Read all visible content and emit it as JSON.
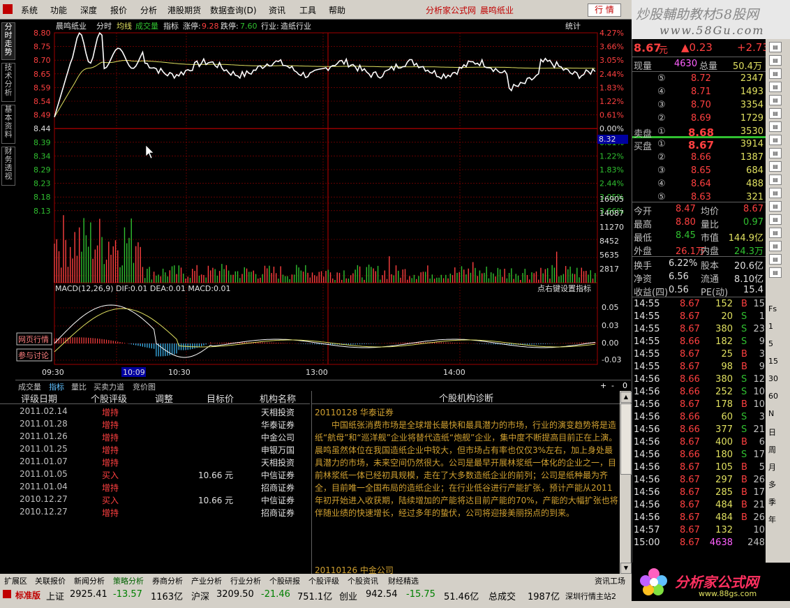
{
  "menu": {
    "items": [
      "系统",
      "功能",
      "深度",
      "报价",
      "分析",
      "港股期货",
      "数据查询(D)",
      "资讯",
      "工具",
      "帮助"
    ],
    "brand": "分析家公式网",
    "stock_name": "晨鸣纸业",
    "quote_button": "行 情"
  },
  "watermark": {
    "line1": "炒股輔助教材58股网",
    "line2": "www.58Gu.com"
  },
  "left_tabs": [
    "分时走势",
    "技术分析",
    "基本资料",
    "财务透视"
  ],
  "chart": {
    "header": {
      "name": "晨鸣纸业",
      "minute": "分时",
      "avg": "均线",
      "vol": "成交量",
      "indicator": "指标",
      "limit_up_label": "涨停:",
      "limit_up": "9.28",
      "limit_down_label": "跌停:",
      "limit_down": "7.60",
      "industry_label": "行业:",
      "industry": "造纸行业",
      "stats": "统计"
    },
    "price_left_ticks": [
      "8.80",
      "8.75",
      "8.70",
      "8.65",
      "8.59",
      "8.54",
      "8.49",
      "8.44",
      "8.39",
      "8.34",
      "8.29",
      "8.23",
      "8.18",
      "8.13"
    ],
    "pct_right_ticks": [
      "4.27%",
      "3.66%",
      "3.05%",
      "2.44%",
      "1.83%",
      "1.22%",
      "0.61%",
      "0.00%",
      "0.61%",
      "1.22%",
      "1.83%",
      "2.44%",
      "3.05%",
      "3.66%"
    ],
    "cursor_price": "8.32",
    "vol_ticks": [
      "16905",
      "14087",
      "11270",
      "8452",
      "5635",
      "2817"
    ],
    "macd_header": "MACD(12,26,9)  DIF:0.01  DEA:0.01  MACD:0.01",
    "macd_hint": "点右键设置指标",
    "macd_ticks": [
      "0.05",
      "0.03",
      "0.00",
      "-0.03"
    ],
    "side_buttons": [
      "网页行情",
      "参与讨论"
    ],
    "time_labels": [
      "09:30",
      "10:09",
      "10:30",
      "13:00",
      "14:00"
    ]
  },
  "chart_tabs": [
    "成交量",
    "指标",
    "量比",
    "买卖力道",
    "竞价图"
  ],
  "chart_tab_controls": [
    "+",
    "-",
    "0"
  ],
  "rating": {
    "headers": [
      "评级日期",
      "个股评级",
      "调整",
      "目标价",
      "机构名称"
    ],
    "rows": [
      {
        "date": "2011.02.14",
        "rating": "增持",
        "adjust": "",
        "target": "",
        "org": "天相投资",
        "buy": false
      },
      {
        "date": "2011.01.28",
        "rating": "增持",
        "adjust": "",
        "target": "",
        "org": "华泰证券",
        "buy": false
      },
      {
        "date": "2011.01.26",
        "rating": "增持",
        "adjust": "",
        "target": "",
        "org": "中金公司",
        "buy": false
      },
      {
        "date": "2011.01.25",
        "rating": "增持",
        "adjust": "",
        "target": "",
        "org": "申银万国",
        "buy": false
      },
      {
        "date": "2011.01.07",
        "rating": "增持",
        "adjust": "",
        "target": "",
        "org": "天相投资",
        "buy": false
      },
      {
        "date": "2011.01.05",
        "rating": "买入",
        "adjust": "",
        "target": "10.66 元",
        "org": "中信证券",
        "buy": true
      },
      {
        "date": "2011.01.04",
        "rating": "增持",
        "adjust": "",
        "target": "",
        "org": "招商证券",
        "buy": false
      },
      {
        "date": "2010.12.27",
        "rating": "买入",
        "adjust": "",
        "target": "10.66 元",
        "org": "中信证券",
        "buy": true
      },
      {
        "date": "2010.12.27",
        "rating": "增持",
        "adjust": "",
        "target": "",
        "org": "招商证券",
        "buy": false
      }
    ]
  },
  "diagnosis": {
    "title": "个股机构诊断",
    "date1": "20110128  华泰证券",
    "body": "中国纸张消费市场是全球增长最快和最具潜力的市场，行业的演变趋势将是造纸“航母”和“巡洋舰”企业将替代造纸“炮舰”企业，集中度不断提高目前正在上演。晨鸣虽然体位在我国造纸企业中较大，但市场占有率也仅仅3%左右，加上身处最具潜力的市场，未来空间仍然很大。公司是最早开展林浆纸一体化的企业之一，目前林浆纸一体已经初具规模，走在了大多数造纸企业的前列；公司是纸种最为齐全，目前唯一全国布局的造纸企业；在行业低谷进行产能扩张，预计产能从2011年初开始进入收获期，陆续增加的产能将达目前产能的70%，产能的大幅扩张也将伴随业绩的快速增长，经过多年的蛰伏，公司将迎接美丽拐点的到来。",
    "date2": "20110126  中金公司"
  },
  "quote": {
    "price": "8.67",
    "unit": "元",
    "change": "▲0.23",
    "pct": "+2.73",
    "xianliang_label": "现量",
    "xianliang": "4630",
    "zongliang_label": "总量",
    "zongliang": "50.4万",
    "sell": [
      {
        "lvl": "⑤",
        "price": "8.72",
        "vol": "2347"
      },
      {
        "lvl": "④",
        "price": "8.71",
        "vol": "1493"
      },
      {
        "lvl": "③",
        "price": "8.70",
        "vol": "3354"
      },
      {
        "lvl": "②",
        "price": "8.69",
        "vol": "1729"
      },
      {
        "lvl": "①",
        "price": "8.68",
        "vol": "3530",
        "label": "卖盘"
      }
    ],
    "buy": [
      {
        "lvl": "①",
        "price": "8.67",
        "vol": "3914",
        "label": "买盘"
      },
      {
        "lvl": "②",
        "price": "8.66",
        "vol": "1387"
      },
      {
        "lvl": "③",
        "price": "8.65",
        "vol": "684"
      },
      {
        "lvl": "④",
        "price": "8.64",
        "vol": "488"
      },
      {
        "lvl": "⑤",
        "price": "8.63",
        "vol": "321"
      }
    ],
    "stats": [
      {
        "l1": "今开",
        "v1": "8.47",
        "l2": "均价",
        "v2": "8.67"
      },
      {
        "l1": "最高",
        "v1": "8.80",
        "l2": "量比",
        "v2": "0.97"
      },
      {
        "l1": "最低",
        "v1": "8.45",
        "l2": "市值",
        "v2": "144.9亿"
      },
      {
        "l1": "外盘",
        "v1": "26.1万",
        "l2": "内盘",
        "v2": "24.3万"
      }
    ],
    "fund": [
      {
        "l1": "换手",
        "v1": "6.22%",
        "l2": "股本",
        "v2": "20.6亿"
      },
      {
        "l1": "净资",
        "v1": "6.56",
        "l2": "流通",
        "v2": "8.10亿"
      },
      {
        "l1": "收益(四)",
        "v1": "0.56",
        "l2": "PE(动)",
        "v2": "15.4"
      }
    ],
    "ticks": [
      {
        "t": "14:55",
        "p": "8.67",
        "v": "152",
        "d": "B",
        "n": "15"
      },
      {
        "t": "14:55",
        "p": "8.67",
        "v": "20",
        "d": "S",
        "n": "1"
      },
      {
        "t": "14:55",
        "p": "8.67",
        "v": "380",
        "d": "S",
        "n": "23"
      },
      {
        "t": "14:55",
        "p": "8.66",
        "v": "182",
        "d": "S",
        "n": "9"
      },
      {
        "t": "14:55",
        "p": "8.67",
        "v": "25",
        "d": "B",
        "n": "3"
      },
      {
        "t": "14:55",
        "p": "8.67",
        "v": "98",
        "d": "B",
        "n": "9"
      },
      {
        "t": "14:56",
        "p": "8.66",
        "v": "380",
        "d": "S",
        "n": "12"
      },
      {
        "t": "14:56",
        "p": "8.66",
        "v": "252",
        "d": "S",
        "n": "10"
      },
      {
        "t": "14:56",
        "p": "8.67",
        "v": "178",
        "d": "B",
        "n": "10"
      },
      {
        "t": "14:56",
        "p": "8.66",
        "v": "60",
        "d": "S",
        "n": "3"
      },
      {
        "t": "14:56",
        "p": "8.66",
        "v": "377",
        "d": "S",
        "n": "21"
      },
      {
        "t": "14:56",
        "p": "8.67",
        "v": "400",
        "d": "B",
        "n": "6"
      },
      {
        "t": "14:56",
        "p": "8.66",
        "v": "180",
        "d": "S",
        "n": "17"
      },
      {
        "t": "14:56",
        "p": "8.67",
        "v": "105",
        "d": "B",
        "n": "5"
      },
      {
        "t": "14:56",
        "p": "8.67",
        "v": "297",
        "d": "B",
        "n": "26"
      },
      {
        "t": "14:56",
        "p": "8.67",
        "v": "285",
        "d": "B",
        "n": "17"
      },
      {
        "t": "14:56",
        "p": "8.67",
        "v": "484",
        "d": "B",
        "n": "21"
      },
      {
        "t": "14:56",
        "p": "8.67",
        "v": "484",
        "d": "B",
        "n": "26"
      },
      {
        "t": "14:57",
        "p": "8.67",
        "v": "132",
        "d": "",
        "n": "10"
      },
      {
        "t": "15:00",
        "p": "8.67",
        "v": "4638",
        "d": "",
        "n": "248"
      }
    ]
  },
  "right_icons": [
    "Fs",
    "1",
    "5",
    "15",
    "30",
    "60",
    "N",
    "日",
    "周",
    "月",
    "多",
    "季",
    "年"
  ],
  "toolbar": [
    "扩展区",
    "关联报价",
    "新闻分析",
    "策略分析",
    "券商分析",
    "产业分析",
    "行业分析",
    "个股研报",
    "个股评级",
    "个股资讯",
    "财经精选",
    "资讯工场",
    "笔"
  ],
  "status": {
    "edition": "标准版",
    "sh_label": "上证",
    "sh": "2925.41",
    "sh_chg": "-13.57",
    "sh_amt": "1163亿",
    "sz_label": "沪深",
    "sz": "3209.50",
    "sz_chg": "-21.46",
    "sz_amt": "751.1亿",
    "cy_label": "创业",
    "cy": "942.54",
    "cy_chg": "-15.75",
    "cy_amt": "51.46亿",
    "total_label": "总成交",
    "total": "1987亿",
    "server": "深圳行情主站2"
  },
  "logo": {
    "text": "分析家公式网",
    "url": "www.88gs.com"
  },
  "colors": {
    "up": "#ff4040",
    "down": "#30c030",
    "price_line": "#ffffff",
    "avg_line": "#e0e060",
    "grid": "#a00000",
    "info": "#d0a030"
  }
}
